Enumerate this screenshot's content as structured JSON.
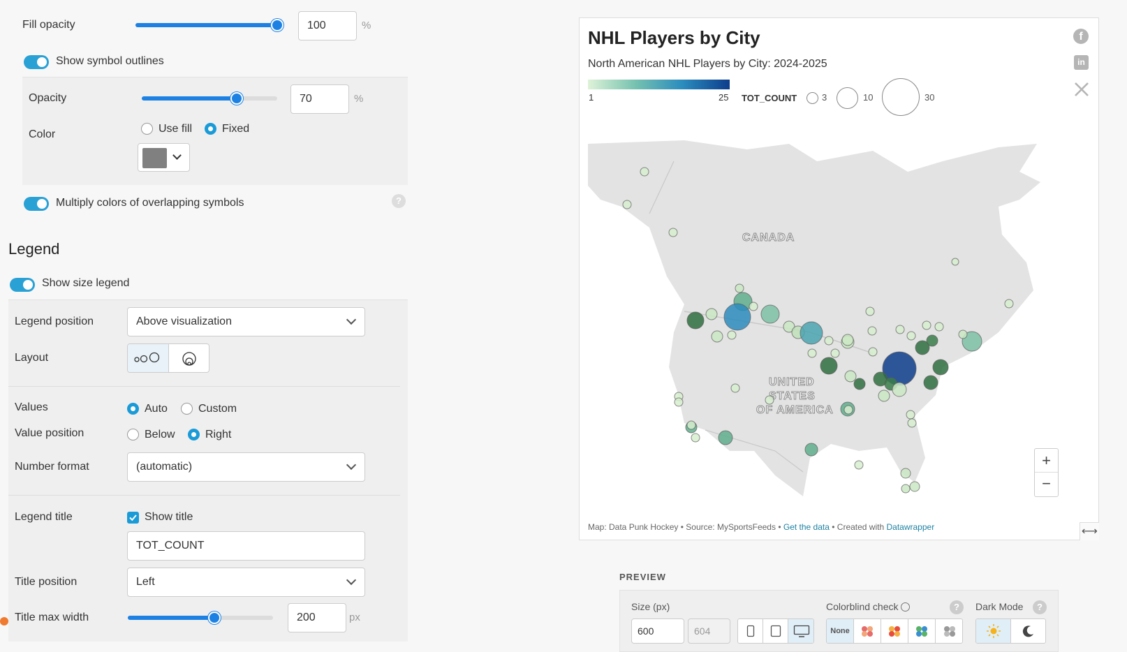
{
  "symbol": {
    "fill_opacity_label": "Fill opacity",
    "fill_opacity_value": "100",
    "fill_opacity_fraction": 1.0,
    "percent": "%",
    "show_outlines_label": "Show symbol outlines",
    "opacity_label": "Opacity",
    "opacity_value": "70",
    "opacity_fraction": 0.7,
    "color_label": "Color",
    "use_fill_label": "Use fill",
    "fixed_label": "Fixed",
    "fixed_color": "#808080",
    "multiply_label": "Multiply colors of overlapping symbols",
    "help_glyph": "?"
  },
  "legend": {
    "heading": "Legend",
    "show_size_legend_label": "Show size legend",
    "position_label": "Legend position",
    "position_value": "Above visualization",
    "layout_label": "Layout",
    "values_label": "Values",
    "auto_label": "Auto",
    "custom_label": "Custom",
    "value_position_label": "Value position",
    "below_label": "Below",
    "right_label": "Right",
    "number_format_label": "Number format",
    "number_format_value": "(automatic)",
    "legend_title_label": "Legend title",
    "show_title_label": "Show title",
    "title_value": "TOT_COUNT",
    "title_position_label": "Title position",
    "title_position_value": "Left",
    "title_max_width_label": "Title max width",
    "title_max_width_value": "200",
    "title_max_width_fraction": 0.6,
    "px_unit": "px"
  },
  "map": {
    "title": "NHL Players by City",
    "subtitle": "North American NHL Players by City: 2024-2025",
    "color_min": "1",
    "color_max": "25",
    "color_low": "#dff2d8",
    "color_high": "#0d3d8c",
    "size_legend_title": "TOT_COUNT",
    "size_values": [
      "3",
      "10",
      "30"
    ],
    "region_canada": "CANADA",
    "region_usa_1": "UNITED",
    "region_usa_2": "STATES",
    "region_usa_3": "OF AMERICA",
    "zoom_in": "+",
    "zoom_out": "−",
    "footer_prefix": "Map: Data Punk Hockey • Source: MySportsFeeds • ",
    "get_data": "Get the data",
    "footer_mid": " • Created with ",
    "datawrapper": "Datawrapper",
    "link_color": "#1d81a2"
  },
  "preview": {
    "heading": "PREVIEW",
    "size_label": "Size (px)",
    "width_value": "600",
    "height_value": "604",
    "colorblind_label": "Colorblind check",
    "none_label": "None",
    "dark_mode_label": "Dark Mode",
    "help_glyph": "?"
  }
}
